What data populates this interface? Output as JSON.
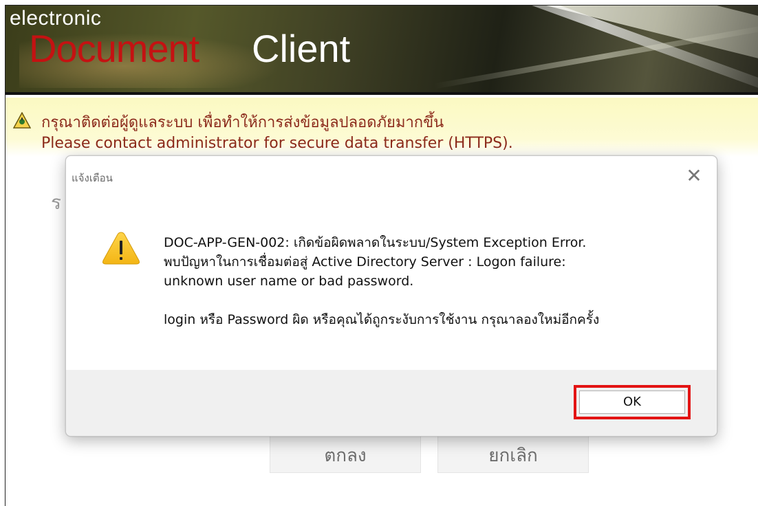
{
  "banner": {
    "logo_small": "electronic",
    "logo_document": "Document",
    "logo_client": "Client"
  },
  "warning": {
    "icon": "warning-triangle-icon",
    "thai_text": "กรุณาติดต่อผู้ดูแลระบบ เพื่อทำให้การส่งข้อมูลปลอดภัยมากขึ้น",
    "english_text": "Please contact administrator for secure data transfer (HTTPS)."
  },
  "background_form": {
    "fragment": "ร",
    "ok_label": "ตกลง",
    "cancel_label": "ยกเลิก"
  },
  "dialog": {
    "title": "แจ้งเตือน",
    "close_icon": "close-icon",
    "icon": "warning-icon",
    "message_line1": "DOC-APP-GEN-002: เกิดข้อผิดพลาดในระบบ/System Exception Error.",
    "message_line2": "พบปัญหาในการเชื่อมต่อสู่ Active Directory Server : Logon failure:",
    "message_line3": "unknown user name or bad password.",
    "message_line4": "login หรือ Password ผิด หรือคุณได้ถูกระงับการใช้งาน กรุณาลองใหม่อีกครั้ง",
    "ok_label": "OK",
    "highlight_color": "#e31414"
  }
}
